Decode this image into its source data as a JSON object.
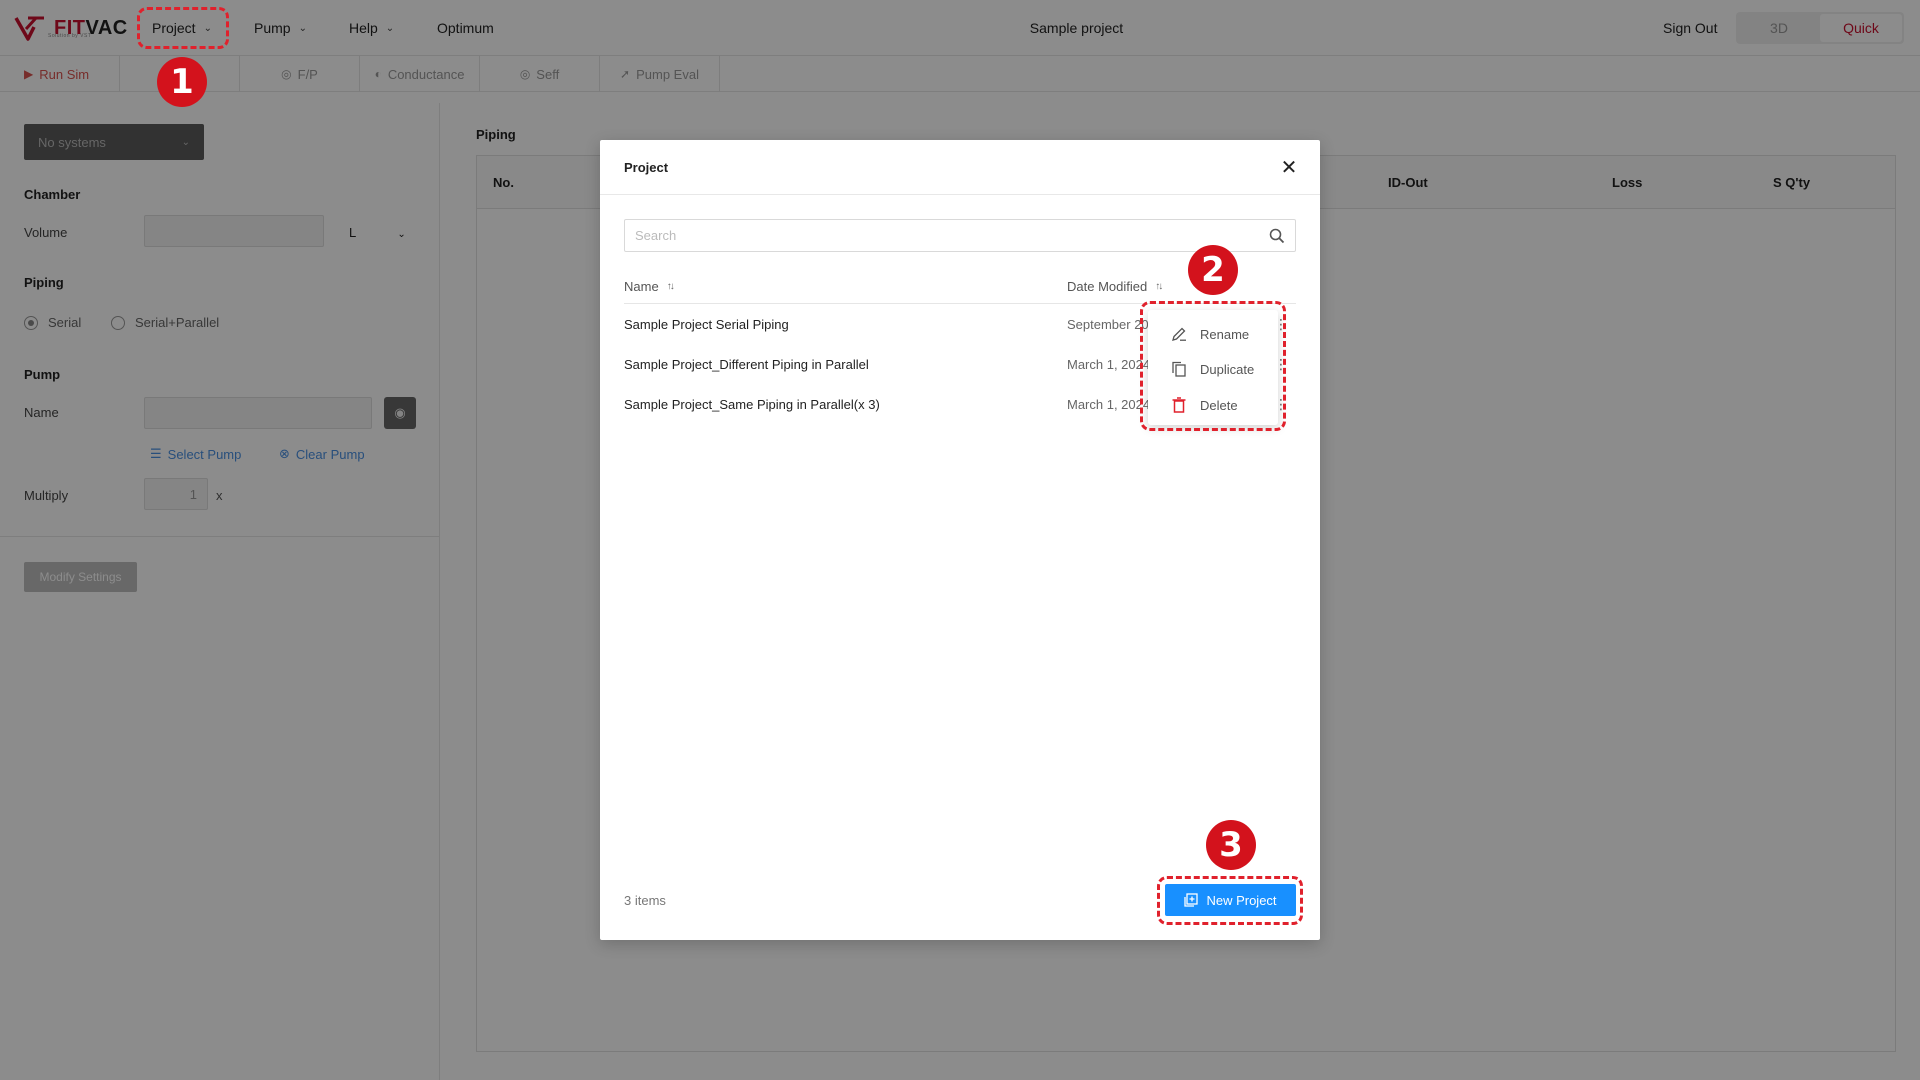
{
  "app": {
    "logo_text_fit": "FIT",
    "logo_text_vac": "VAC",
    "logo_subtitle": "Solution by VST",
    "project_title": "Sample project",
    "sign_out": "Sign Out",
    "view_modes": [
      "3D",
      "Quick"
    ],
    "active_view": "Quick",
    "accent": "#c8102e",
    "primary_blue": "#1890ff"
  },
  "nav": {
    "project": "Project",
    "pump": "Pump",
    "help": "Help",
    "optimum": "Optimum"
  },
  "toolbar": {
    "run_sim": "Run Sim",
    "fp": "F/P",
    "conductance": "Conductance",
    "seff": "Seff",
    "pump_eval": "Pump Eval"
  },
  "left": {
    "system_select": "No systems",
    "chamber_title": "Chamber",
    "volume_label": "Volume",
    "volume_unit": "L",
    "piping_title": "Piping",
    "radio_serial": "Serial",
    "radio_serial_parallel": "Serial+Parallel",
    "pump_title": "Pump",
    "name_label": "Name",
    "select_pump": "Select Pump",
    "clear_pump": "Clear Pump",
    "multiply_label": "Multiply",
    "multiply_value": "1",
    "multiply_unit": "x",
    "modify_settings": "Modify Settings"
  },
  "main": {
    "title": "Piping",
    "columns": [
      "No.",
      "ID-Out",
      "Loss",
      "S Q'ty"
    ]
  },
  "modal": {
    "title": "Project",
    "search_placeholder": "Search",
    "col_name": "Name",
    "col_date": "Date Modified",
    "rows": [
      {
        "name": "Sample Project Serial Piping",
        "date": "September 20"
      },
      {
        "name": "Sample Project_Different Piping in Parallel",
        "date": "March 1, 2024"
      },
      {
        "name": "Sample Project_Same Piping in Parallel(x 3)",
        "date": "March 1, 2024"
      }
    ],
    "items_count": "3 items",
    "new_project": "New Project"
  },
  "context_menu": {
    "rename": "Rename",
    "duplicate": "Duplicate",
    "delete": "Delete"
  },
  "callouts": [
    "1",
    "2",
    "3"
  ]
}
